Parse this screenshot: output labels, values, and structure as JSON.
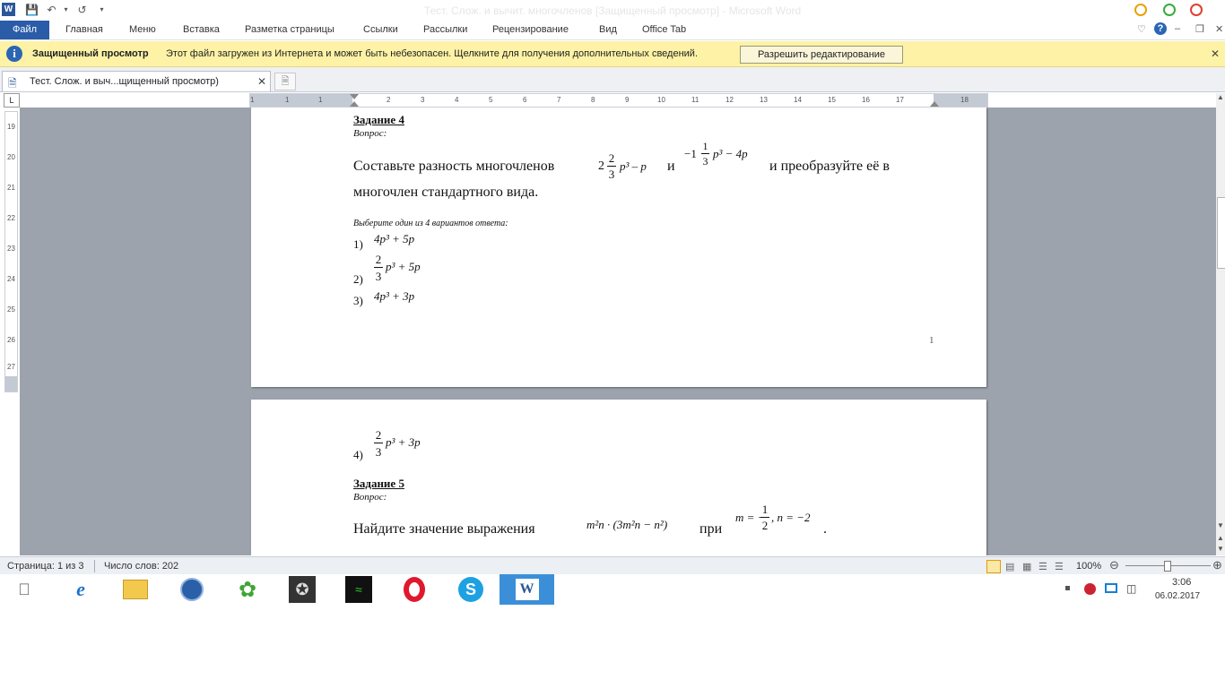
{
  "window": {
    "title": "Тест. Слож. и вычит. многочленов [Защищенный просмотр] - Microsoft Word"
  },
  "ribbon": {
    "file_tab": "Файл",
    "tabs": [
      "Главная",
      "Меню",
      "Вставка",
      "Разметка страницы",
      "Ссылки",
      "Рассылки",
      "Рецензирование",
      "Вид",
      "Office Tab"
    ]
  },
  "protected_view": {
    "title": "Защищенный просмотр",
    "message": "Этот файл загружен из Интернета и может быть небезопасен. Щелкните для получения дополнительных сведений.",
    "button_label": "Разрешить редактирование"
  },
  "doc_tab": {
    "label": "Тест. Слож. и выч...щищенный просмотр)"
  },
  "ruler": {
    "box_label": "L",
    "h_labels": [
      "1",
      "1",
      "1",
      "2",
      "3",
      "4",
      "5",
      "6",
      "7",
      "8",
      "9",
      "10",
      "11",
      "12",
      "13",
      "14",
      "15",
      "16",
      "17",
      "18"
    ],
    "v_labels": [
      "19",
      "20",
      "21",
      "22",
      "23",
      "24",
      "25",
      "26",
      "27"
    ]
  },
  "page1": {
    "task_title": "Задание 4",
    "question_label": "Вопрос:",
    "question_line1_a": "Составьте разность многочленов",
    "question_and": "и",
    "question_line1_b": "и преобразуйте её в",
    "question_line2": "многочлен стандартного вида.",
    "poly1": {
      "whole": "2",
      "num": "2",
      "den": "3",
      "tail": "p³ – p"
    },
    "poly2": {
      "whole": "−1",
      "num": "1",
      "den": "3",
      "tail": "p³ − 4p"
    },
    "choose_label": "Выберите один из 4 вариантов ответа:",
    "options": [
      {
        "num": "1)",
        "expr": "4p³ + 5p"
      },
      {
        "num": "2)",
        "frac_num": "2",
        "frac_den": "3",
        "expr": "p³ + 5p"
      },
      {
        "num": "3)",
        "expr": "4p³ + 3p"
      }
    ],
    "page_number": "1"
  },
  "page2": {
    "option4": {
      "num": "4)",
      "frac_num": "2",
      "frac_den": "3",
      "expr": "p³ + 3p"
    },
    "task_title": "Задание 5",
    "question_label": "Вопрос:",
    "question_text": "Найдите значение выражения",
    "expr": "m²n · (3m²n − n²)",
    "when": "при",
    "cond_m": "m = −",
    "cond_frac_num": "1",
    "cond_frac_den": "2",
    "cond_n": ", n = −2",
    "period": "."
  },
  "status": {
    "page": "Страница: 1 из 3",
    "words": "Число слов: 202",
    "zoom": "100%"
  },
  "tray": {
    "time": "3:06",
    "date": "06.02.2017"
  },
  "taskbar_icons": [
    "apple-icon",
    "internet-explorer-icon",
    "file-explorer-icon",
    "thunderbird-icon",
    "icq-icon",
    "star-app-icon",
    "terminal-app-icon",
    "opera-icon",
    "skype-icon",
    "word-icon"
  ]
}
